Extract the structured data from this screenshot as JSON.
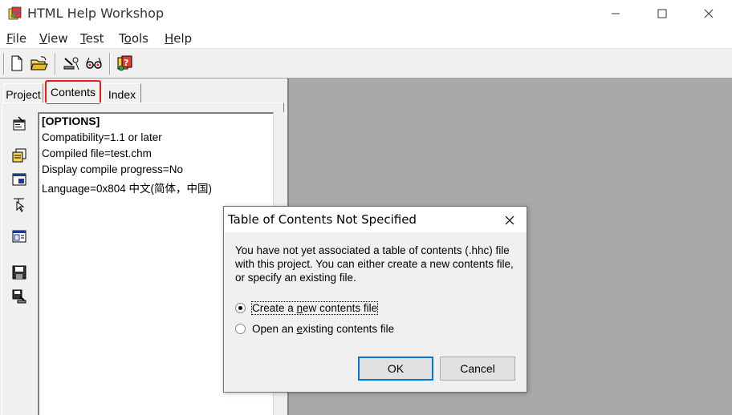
{
  "window": {
    "title": "HTML Help Workshop"
  },
  "menu": {
    "items": [
      {
        "first": "F",
        "rest": "ile"
      },
      {
        "first": "V",
        "rest": "iew"
      },
      {
        "first": "T",
        "rest": "est"
      },
      {
        "pre": "T",
        "first": "o",
        "rest": "ols"
      },
      {
        "first": "H",
        "rest": "elp"
      }
    ]
  },
  "toolbar": {
    "icons": [
      "new-file-icon",
      "open-folder-icon",
      "compile-icon",
      "view-compiled-icon",
      "help-icon"
    ]
  },
  "tabs": {
    "project": "Project",
    "contents": "Contents",
    "index": "Index"
  },
  "side_toolbar": {
    "icons": [
      "change-options-icon",
      "add-file-icon",
      "add-window-icon",
      "add-map-icon",
      "api-info-icon",
      "save-icon",
      "save-compile-icon"
    ]
  },
  "project_text": {
    "lines": [
      "[OPTIONS]",
      "Compatibility=1.1 or later",
      "Compiled file=test.chm",
      "Display compile progress=No",
      "Language=0x804 中文(简体，中国)"
    ]
  },
  "dialog": {
    "title": "Table of Contents Not Specified",
    "message_line1": "You have not yet associated a table of contents (.hhc) file",
    "message_line2": "with this project. You can either create a new contents file,",
    "message_line3": "or specify an existing file.",
    "option_create": {
      "pre": "Create a ",
      "ul": "n",
      "post": "ew contents file",
      "selected": true
    },
    "option_open": {
      "pre": "Open an ",
      "ul": "e",
      "post": "xisting contents file",
      "selected": false
    },
    "ok_label": "OK",
    "cancel_label": "Cancel"
  },
  "colors": {
    "highlight_border": "#e81f1f",
    "workspace_gray": "#a9a9a9",
    "ok_focus": "#0078d7"
  }
}
